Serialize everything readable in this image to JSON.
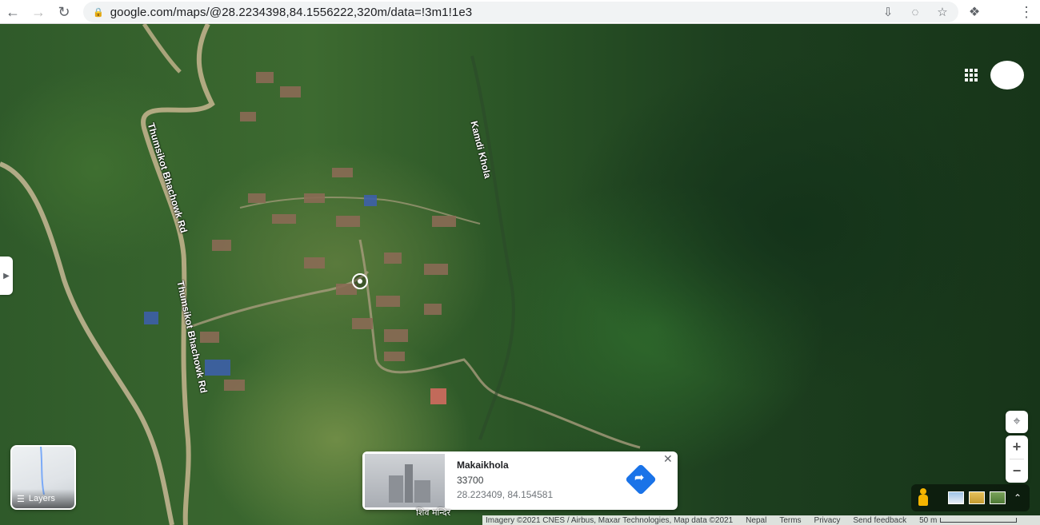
{
  "browser": {
    "url": "google.com/maps/@28.2234398,84.1556222,320m/data=!3m1!1e3",
    "back_icon": "arrow-left-icon",
    "forward_icon": "arrow-right-icon",
    "reload_icon": "reload-icon"
  },
  "map": {
    "road_label_1": "Thumsikot Bhachowk Rd",
    "road_label_2": "Thumsikot Bhachowk Rd",
    "river_label": "Kamdi Khola",
    "poi_label": "शिव मन्दिर"
  },
  "layers": {
    "label": "Layers"
  },
  "info_card": {
    "title": "Makaikhola",
    "postal_code": "33700",
    "coordinates": "28.223409, 84.154581"
  },
  "footer": {
    "imagery": "Imagery ©2021 CNES / Airbus, Maxar Technologies, Map data ©2021",
    "country": "Nepal",
    "terms": "Terms",
    "privacy": "Privacy",
    "feedback": "Send feedback",
    "scale": "50 m"
  },
  "controls": {
    "zoom_in": "+",
    "zoom_out": "−"
  }
}
